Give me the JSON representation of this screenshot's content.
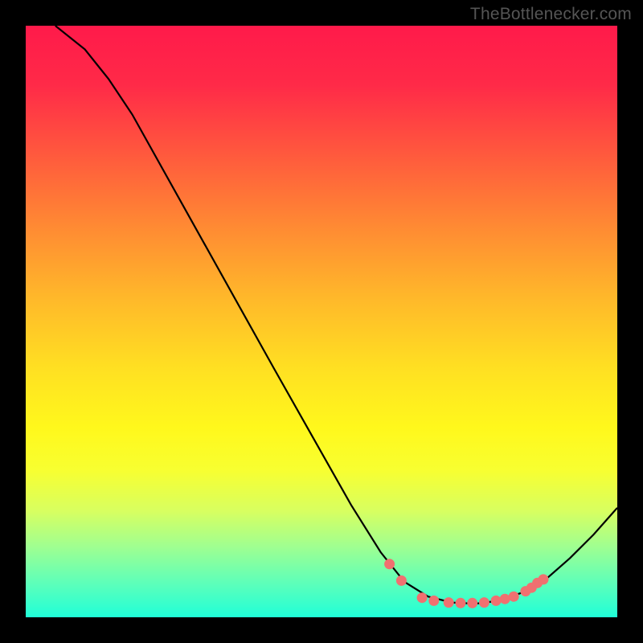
{
  "attribution": "TheBottlenecker.com",
  "chart_data": {
    "type": "line",
    "title": "",
    "xlabel": "",
    "ylabel": "",
    "xlim": [
      0,
      100
    ],
    "ylim": [
      0,
      100
    ],
    "curve": [
      {
        "x": 5,
        "y": 100
      },
      {
        "x": 10,
        "y": 96
      },
      {
        "x": 14,
        "y": 91
      },
      {
        "x": 18,
        "y": 85
      },
      {
        "x": 42,
        "y": 42
      },
      {
        "x": 55,
        "y": 19
      },
      {
        "x": 60,
        "y": 11
      },
      {
        "x": 64,
        "y": 6
      },
      {
        "x": 68,
        "y": 3.5
      },
      {
        "x": 72,
        "y": 2.5
      },
      {
        "x": 76,
        "y": 2.3
      },
      {
        "x": 80,
        "y": 2.8
      },
      {
        "x": 84,
        "y": 4.2
      },
      {
        "x": 88,
        "y": 6.5
      },
      {
        "x": 92,
        "y": 10
      },
      {
        "x": 96,
        "y": 14
      },
      {
        "x": 100,
        "y": 18.5
      }
    ],
    "dots": [
      {
        "x": 61.5,
        "y": 9.0
      },
      {
        "x": 63.5,
        "y": 6.2
      },
      {
        "x": 67.0,
        "y": 3.3
      },
      {
        "x": 69.0,
        "y": 2.8
      },
      {
        "x": 71.5,
        "y": 2.5
      },
      {
        "x": 73.5,
        "y": 2.4
      },
      {
        "x": 75.5,
        "y": 2.4
      },
      {
        "x": 77.5,
        "y": 2.5
      },
      {
        "x": 79.5,
        "y": 2.8
      },
      {
        "x": 81.0,
        "y": 3.1
      },
      {
        "x": 82.5,
        "y": 3.5
      },
      {
        "x": 84.5,
        "y": 4.4
      },
      {
        "x": 85.5,
        "y": 5.0
      },
      {
        "x": 86.5,
        "y": 5.8
      },
      {
        "x": 87.5,
        "y": 6.4
      }
    ],
    "gradient_stops": [
      {
        "pos": 0,
        "color": "#ff1a4a"
      },
      {
        "pos": 100,
        "color": "#20ffd8"
      }
    ]
  }
}
